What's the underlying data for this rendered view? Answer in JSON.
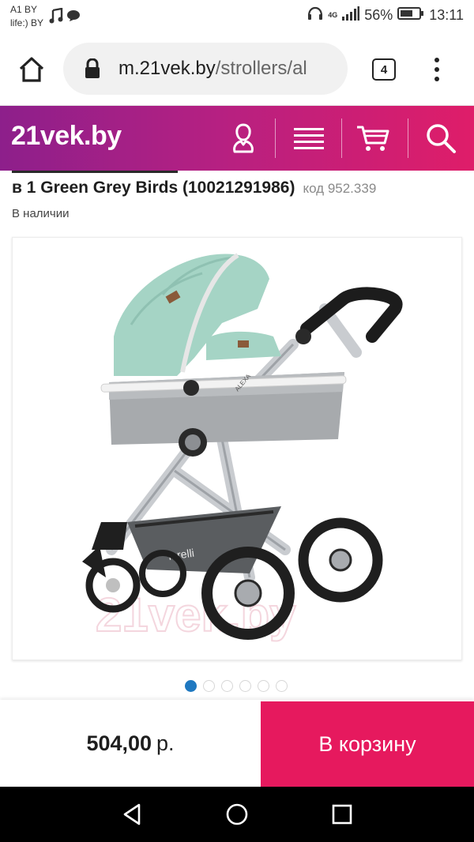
{
  "status_bar": {
    "carrier_1": "A1 BY",
    "carrier_2": "life:) BY",
    "battery_percent": "56%",
    "time": "13:11",
    "network": "4G",
    "icons": [
      "music-note-icon",
      "chat-bubble-icon",
      "headphones-icon",
      "signal-icon",
      "battery-icon"
    ]
  },
  "browser": {
    "url_host": "m.21vek.by",
    "url_path": "/strollers/al",
    "tab_count": "4",
    "icons": [
      "home-icon",
      "lock-icon",
      "more-vert-icon"
    ]
  },
  "site_header": {
    "logo": "21vek.by",
    "icons": [
      "account-icon",
      "menu-icon",
      "cart-icon",
      "search-icon"
    ],
    "colors": {
      "gradient_start": "#8d1f8b",
      "gradient_end": "#df1d69"
    }
  },
  "product": {
    "title": "в 1 Green Grey Birds (10021291986)",
    "code": "код 952.339",
    "availability": "В наличии",
    "image_watermark": "21vek.by",
    "brand_on_image": "lorelli",
    "label_on_image": "ALEXA"
  },
  "carousel": {
    "count": 6,
    "active_index": 0,
    "active_color": "#1f78c0"
  },
  "purchase": {
    "price_value": "504,00",
    "price_currency": "р.",
    "cart_button": "В корзину",
    "cart_button_color": "#e6195e"
  },
  "system_nav": {
    "icons": [
      "back-icon",
      "home-circle-icon",
      "recents-icon"
    ]
  }
}
